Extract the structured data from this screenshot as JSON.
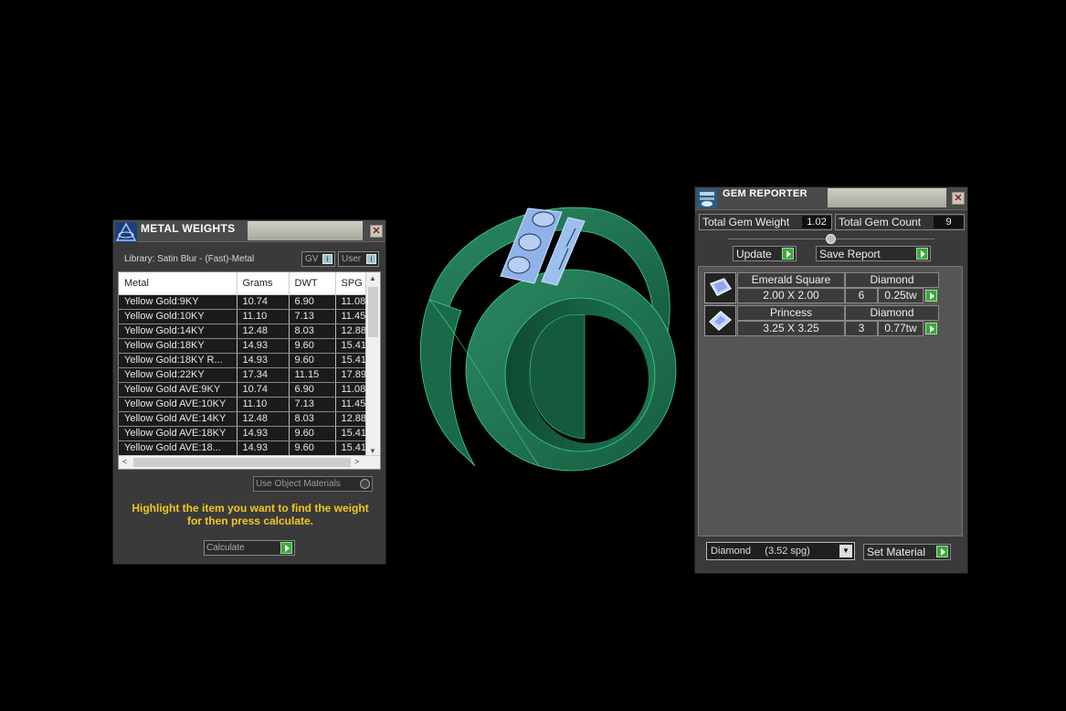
{
  "metal_weights": {
    "title": "METAL WEIGHTS",
    "close": "✕",
    "library_label": "Library: Satin Blur - (Fast)-Metal",
    "gv_label": "GV",
    "user_label": "User",
    "columns": [
      "Metal",
      "Grams",
      "DWT",
      "SPG"
    ],
    "rows": [
      [
        "Yellow Gold:9KY",
        "10.74",
        "6.90",
        "11.08"
      ],
      [
        "Yellow Gold:10KY",
        "11.10",
        "7.13",
        "11.45"
      ],
      [
        "Yellow Gold:14KY",
        "12.48",
        "8.03",
        "12.88"
      ],
      [
        "Yellow Gold:18KY",
        "14.93",
        "9.60",
        "15.41"
      ],
      [
        "Yellow Gold:18KY R...",
        "14.93",
        "9.60",
        "15.41"
      ],
      [
        "Yellow Gold:22KY",
        "17.34",
        "11.15",
        "17.89"
      ],
      [
        "Yellow Gold AVE:9KY",
        "10.74",
        "6.90",
        "11.08"
      ],
      [
        "Yellow Gold AVE:10KY",
        "11.10",
        "7.13",
        "11.45"
      ],
      [
        "Yellow Gold AVE:14KY",
        "12.48",
        "8.03",
        "12.88"
      ],
      [
        "Yellow Gold AVE:18KY",
        "14.93",
        "9.60",
        "15.41"
      ],
      [
        "Yellow Gold AVE:18...",
        "14.93",
        "9.60",
        "15.41"
      ]
    ],
    "use_object_materials": "Use Object Materials",
    "hint_line1": "Highlight the item you want to find the weight",
    "hint_line2": "for then press calculate.",
    "calculate_label": "Calculate"
  },
  "gem_reporter": {
    "title": "GEM REPORTER",
    "close": "✕",
    "total_weight_label": "Total Gem Weight",
    "total_weight_value": "1.02",
    "total_count_label": "Total Gem Count",
    "total_count_value": "9",
    "update_label": "Update",
    "save_report_label": "Save Report",
    "gems": [
      {
        "shape": "Emerald Square",
        "material": "Diamond",
        "size": "2.00 X 2.00",
        "count": "6",
        "weight": "0.25tw"
      },
      {
        "shape": "Princess",
        "material": "Diamond",
        "size": "3.25 X 3.25",
        "count": "3",
        "weight": "0.77tw"
      }
    ],
    "material_select": "Diamond     (3.52 spg)",
    "set_material_label": "Set Material"
  },
  "colors": {
    "ring_green": "#1f7a55",
    "accent_yellow": "#f2c81f",
    "play_green": "#3aa83a"
  }
}
